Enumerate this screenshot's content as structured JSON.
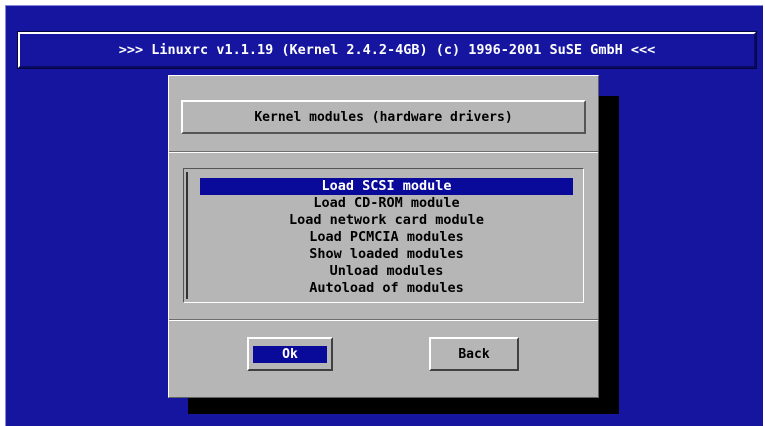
{
  "title_bar": {
    "text": ">>> Linuxrc v1.1.19 (Kernel 2.4.2-4GB) (c) 1996-2001 SuSE GmbH <<<"
  },
  "dialog": {
    "header": "Kernel modules (hardware drivers)",
    "menu": {
      "selected_index": 0,
      "items": [
        {
          "label": "Load SCSI module"
        },
        {
          "label": "Load CD-ROM module"
        },
        {
          "label": "Load network card module"
        },
        {
          "label": "Load PCMCIA modules"
        },
        {
          "label": "Show loaded modules"
        },
        {
          "label": "Unload modules"
        },
        {
          "label": "Autoload of modules"
        }
      ]
    },
    "buttons": {
      "ok": "Ok",
      "back": "Back"
    }
  },
  "colors": {
    "background": "#1515a0",
    "dialog": "#b6b6b6",
    "highlight": "#0a0a9a",
    "text_light": "#ffffff",
    "text_dark": "#000000"
  }
}
